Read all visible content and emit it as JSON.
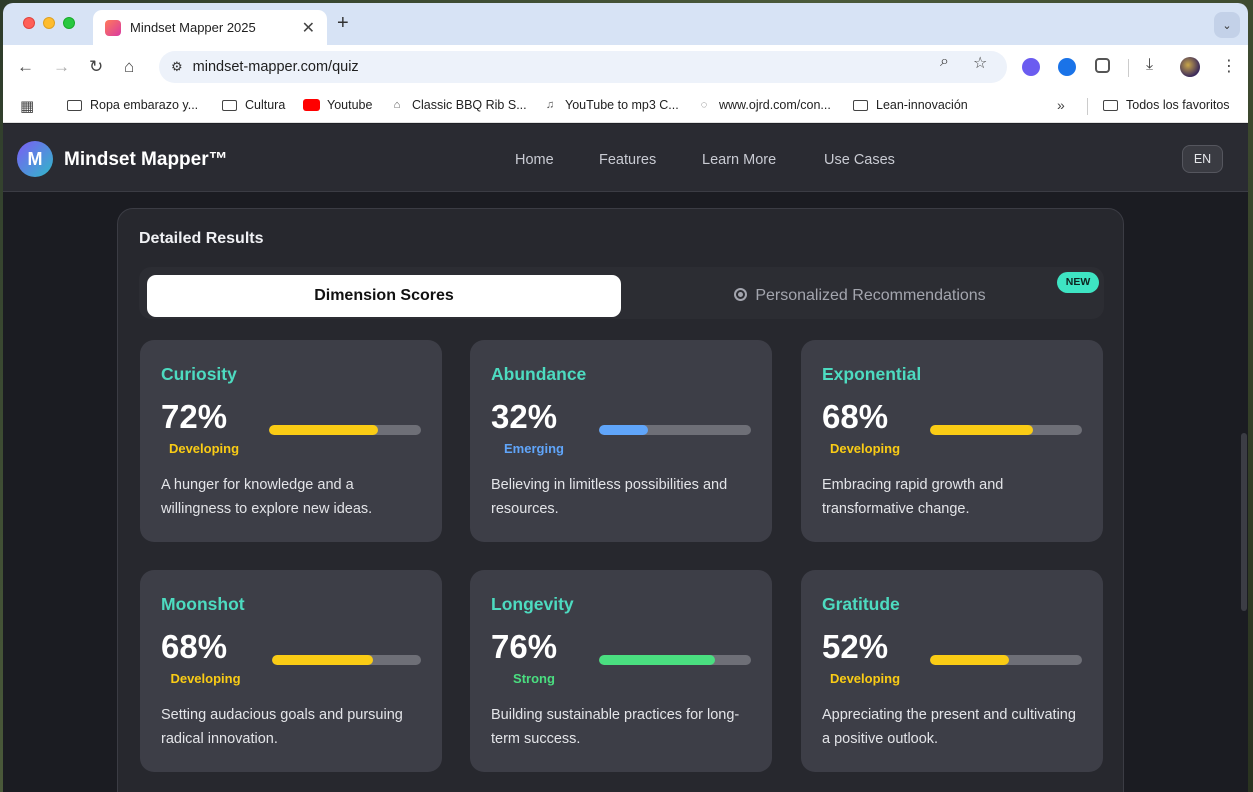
{
  "browser": {
    "tab_title": "Mindset Mapper 2025",
    "tab_close": "✕",
    "new_tab": "+",
    "url": "mindset-mapper.com/quiz",
    "bookmarks": [
      {
        "label": "Ropa embarazo y...",
        "icon": "folder-icon"
      },
      {
        "label": "Cultura",
        "icon": "folder-icon"
      },
      {
        "label": "Youtube",
        "icon": "youtube-icon"
      },
      {
        "label": "Classic BBQ Rib S...",
        "icon": "site-icon"
      },
      {
        "label": "YouTube to mp3 C...",
        "icon": "mp3-icon"
      },
      {
        "label": "www.ojrd.com/con...",
        "icon": "loading-icon"
      },
      {
        "label": "Lean-innovación",
        "icon": "folder-icon"
      }
    ],
    "bookmarks_more": "»",
    "all_bookmarks": "Todos los favoritos"
  },
  "site": {
    "logo_letter": "M",
    "logo_text": "Mindset Mapper™",
    "nav": [
      "Home",
      "Features",
      "Learn More",
      "Use Cases"
    ],
    "lang": "EN"
  },
  "results": {
    "title": "Detailed Results",
    "tab_active": "Dimension Scores",
    "tab_inactive": "Personalized Recommendations",
    "badge": "NEW",
    "cards": [
      {
        "name": "Curiosity",
        "pct": "72%",
        "value": 0.72,
        "level": "Developing",
        "color": "#facc15",
        "desc": "A hunger for knowledge and a willingness to explore new ideas."
      },
      {
        "name": "Abundance",
        "pct": "32%",
        "value": 0.32,
        "level": "Emerging",
        "color": "#60a5fa",
        "desc": "Believing in limitless possibilities and resources."
      },
      {
        "name": "Exponential",
        "pct": "68%",
        "value": 0.68,
        "level": "Developing",
        "color": "#facc15",
        "desc": "Embracing rapid growth and transformative change."
      },
      {
        "name": "Moonshot",
        "pct": "68%",
        "value": 0.68,
        "level": "Developing",
        "color": "#facc15",
        "desc": "Setting audacious goals and pursuing radical innovation."
      },
      {
        "name": "Longevity",
        "pct": "76%",
        "value": 0.76,
        "level": "Strong",
        "color": "#4ade80",
        "desc": "Building sustainable practices for long-term success."
      },
      {
        "name": "Gratitude",
        "pct": "52%",
        "value": 0.52,
        "level": "Developing",
        "color": "#facc15",
        "desc": "Appreciating the present and cultivating a positive outlook."
      }
    ]
  }
}
